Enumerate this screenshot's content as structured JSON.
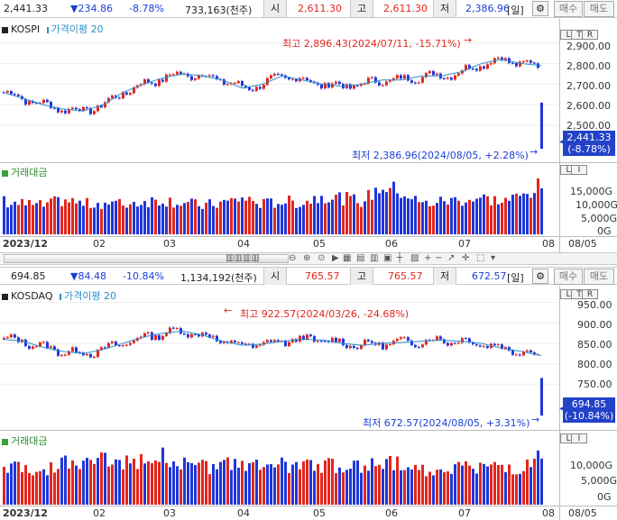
{
  "kospi": {
    "info": {
      "price": "2,441.33",
      "change": "▼234.86",
      "change_pct": "-8.78%",
      "volume": "733,163(천주)",
      "open_label": "시",
      "open": "2,611.30",
      "high_label": "고",
      "high": "2,611.30",
      "low_label": "저",
      "low": "2,386.96",
      "period": "[일]"
    },
    "title": "KOSPI",
    "ma_label": "가격이평 20",
    "volume_label": "거래대금",
    "y_ticks": [
      "2,900.00",
      "2,800.00",
      "2,700.00",
      "2,600.00",
      "2,500.00"
    ],
    "vol_ticks": [
      "15,000G",
      "10,000G",
      "5,000G",
      "0G"
    ],
    "current_price": "2,441.33",
    "current_pct": "(-8.78%)",
    "high_note": "최고 2,896.43(2024/07/11, -15.71%)",
    "low_note": "최저 2,386.96(2024/08/05, +2.28%)"
  },
  "kosdaq": {
    "info": {
      "price": "694.85",
      "change": "▼84.48",
      "change_pct": "-10.84%",
      "volume": "1,134,192(천주)",
      "open_label": "시",
      "open": "765.57",
      "high_label": "고",
      "high": "765.57",
      "low_label": "저",
      "low": "672.57",
      "period": "[일]"
    },
    "title": "KOSDAQ",
    "ma_label": "가격이평 20",
    "volume_label": "거래대금",
    "y_ticks": [
      "950.00",
      "900.00",
      "850.00",
      "800.00",
      "750.00"
    ],
    "vol_ticks": [
      "10,000G",
      "5,000G",
      "0G"
    ],
    "current_price": "694.85",
    "current_pct": "(-10.84%)",
    "high_note": "최고 922.57(2024/03/26, -24.68%)",
    "low_note": "최저 672.57(2024/08/05, +3.31%)"
  },
  "buttons": {
    "buy": "매수",
    "sell": "매도"
  },
  "x_axis": {
    "start": "2023/12",
    "months": [
      "02",
      "03",
      "04",
      "05",
      "06",
      "07",
      "08"
    ],
    "end": "08/05"
  },
  "mini_buttons": [
    "L",
    "T",
    "R",
    "L",
    "I"
  ],
  "colors": {
    "up": "#e2261d",
    "down": "#1f36d8",
    "ma": "#2c8fcc"
  },
  "chart_data": [
    {
      "type": "candlestick",
      "title": "KOSPI",
      "ylim": [
        2386.96,
        2896.43
      ],
      "series": [
        {
          "name": "가격이평 20",
          "values": [
            2660,
            2630,
            2600,
            2580,
            2570,
            2600,
            2660,
            2700,
            2730,
            2750,
            2740,
            2720,
            2680,
            2700,
            2740,
            2720,
            2700,
            2690,
            2700,
            2720,
            2720,
            2740,
            2740,
            2760,
            2800,
            2820,
            2800,
            2790
          ]
        },
        {
          "name": "거래대금",
          "values": [
            11000,
            10000,
            9500,
            11500,
            10000,
            10500,
            10000,
            11000,
            11500,
            10500,
            9500,
            10500,
            12000,
            10000,
            11000,
            10500,
            13000,
            12000,
            11000,
            16000,
            14000,
            10000,
            11000,
            11500,
            12000,
            11000,
            12500,
            17000
          ]
        }
      ]
    },
    {
      "type": "candlestick",
      "title": "KOSDAQ",
      "ylim": [
        672.57,
        922.57
      ],
      "series": [
        {
          "name": "가격이평 20",
          "values": [
            860,
            855,
            840,
            830,
            825,
            835,
            850,
            865,
            875,
            880,
            870,
            855,
            845,
            848,
            855,
            860,
            858,
            850,
            845,
            850,
            852,
            855,
            858,
            855,
            850,
            838,
            830,
            820
          ]
        },
        {
          "name": "거래대금",
          "values": [
            7500,
            7000,
            6500,
            8000,
            7500,
            8500,
            8000,
            8500,
            9000,
            8000,
            7000,
            7500,
            7500,
            7000,
            7500,
            7000,
            7500,
            7000,
            7200,
            8000,
            7500,
            6500,
            6800,
            7000,
            7200,
            7000,
            6500,
            9000
          ]
        }
      ]
    }
  ]
}
